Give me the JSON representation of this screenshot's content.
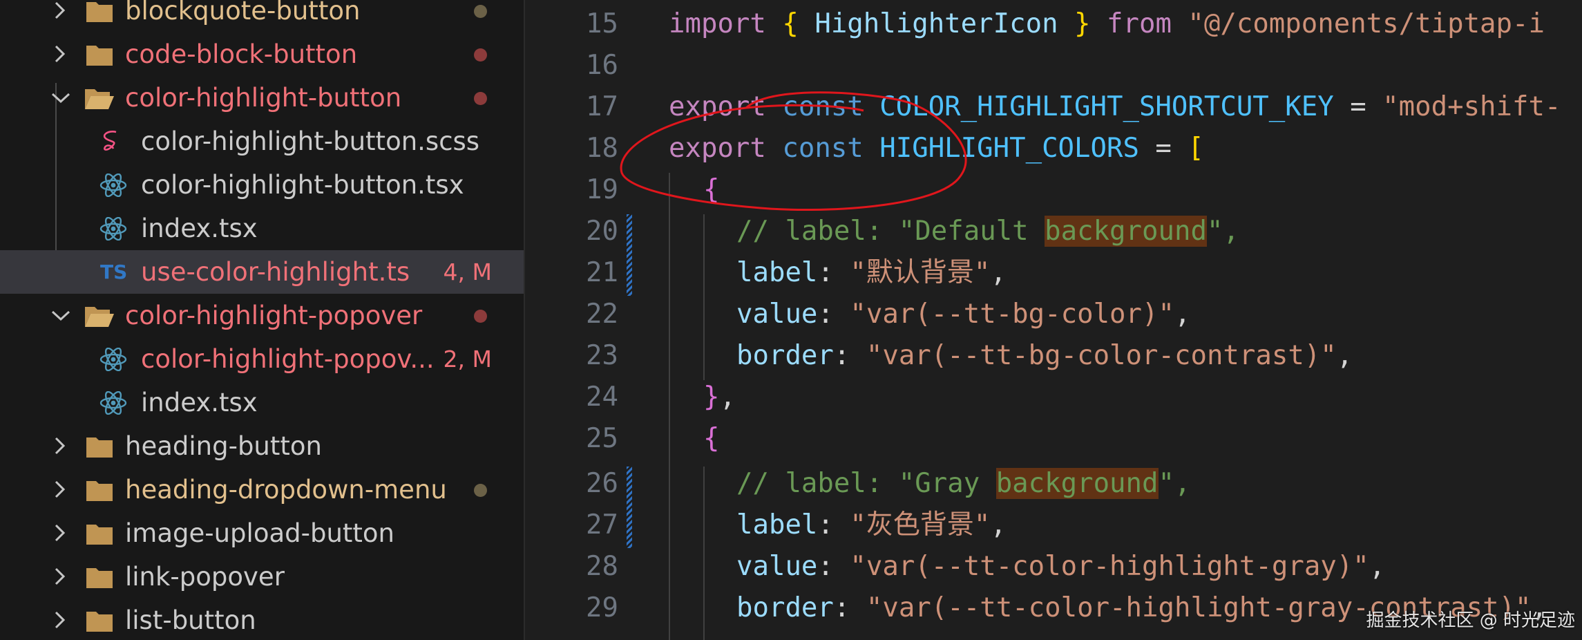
{
  "explorer": {
    "rows": [
      {
        "label": "blockquote-button",
        "color": "#e2c08d",
        "status": "modified-dot"
      },
      {
        "label": "code-block-button",
        "color": "#f07178",
        "status": "error-dot"
      },
      {
        "label": "color-highlight-button",
        "color": "#f07178",
        "status": "error-dot"
      },
      {
        "label": "color-highlight-button.scss",
        "color": "#cccccc",
        "icon": "sass-icon"
      },
      {
        "label": "color-highlight-button.tsx",
        "color": "#cccccc",
        "icon": "react-icon"
      },
      {
        "label": "index.tsx",
        "color": "#cccccc",
        "icon": "react-icon"
      },
      {
        "label": "use-color-highlight.ts",
        "color": "#f07178",
        "icon": "typescript-icon",
        "icon_text": "TS",
        "badge": "4, M"
      },
      {
        "label": "color-highlight-popover",
        "color": "#f07178",
        "status": "error-dot"
      },
      {
        "label": "color-highlight-popov...",
        "color": "#f07178",
        "icon": "react-icon",
        "badge": "2, M"
      },
      {
        "label": "index.tsx",
        "color": "#cccccc",
        "icon": "react-icon"
      },
      {
        "label": "heading-button",
        "color": "#cccccc"
      },
      {
        "label": "heading-dropdown-menu",
        "color": "#e2c08d",
        "status": "modified-dot"
      },
      {
        "label": "image-upload-button",
        "color": "#cccccc"
      },
      {
        "label": "link-popover",
        "color": "#cccccc"
      },
      {
        "label": "list-button",
        "color": "#cccccc"
      }
    ]
  },
  "editor": {
    "line_numbers": [
      "15",
      "16",
      "17",
      "18",
      "19",
      "20",
      "21",
      "22",
      "23",
      "24",
      "25",
      "26",
      "27",
      "28",
      "29"
    ],
    "line15": {
      "import": "import",
      "brace_open": "{ ",
      "name": "HighlighterIcon",
      "brace_close": " }",
      "from": "from",
      "path": "\"@/components/tiptap-i"
    },
    "line17": {
      "export": "export",
      "const": "const",
      "name": "COLOR_HIGHLIGHT_SHORTCUT_KEY",
      "eq": " = ",
      "value": "\"mod+shift-"
    },
    "line18": {
      "export": "export",
      "const": "const",
      "name": "HIGHLIGHT_COLORS",
      "eq": " = ",
      "bracket": "["
    },
    "line19": {
      "brace": "{"
    },
    "line20": {
      "comment_pre": "// label: \"Default ",
      "comment_hl": "background",
      "comment_post": "\","
    },
    "line21": {
      "key": "label",
      "colon": ": ",
      "value": "\"默认背景\"",
      "comma": ","
    },
    "line22": {
      "key": "value",
      "colon": ": ",
      "value": "\"var(--tt-bg-color)\"",
      "comma": ","
    },
    "line23": {
      "key": "border",
      "colon": ": ",
      "value": "\"var(--tt-bg-color-contrast)\"",
      "comma": ","
    },
    "line24": {
      "brace": "}",
      "comma": ","
    },
    "line25": {
      "brace": "{"
    },
    "line26": {
      "comment_pre": "// label: \"Gray ",
      "comment_hl": "background",
      "comment_post": "\","
    },
    "line27": {
      "key": "label",
      "colon": ": ",
      "value": "\"灰色背景\"",
      "comma": ","
    },
    "line28": {
      "key": "value",
      "colon": ": ",
      "value": "\"var(--tt-color-highlight-gray)\"",
      "comma": ","
    },
    "line29": {
      "key": "border",
      "colon": ": ",
      "value": "\"var(--tt-color-highlight-gray-contrast)\"",
      "comma": ","
    }
  },
  "watermark": "掘金技术社区 @ 时光足迹",
  "colors": {
    "error_dot": "#8c3b3b",
    "modified_dot": "#6b6147",
    "folder": "#c09553",
    "react": "#519aba",
    "sass": "#f55385",
    "typescript": "#3178c6",
    "annotation": "#e0161c"
  }
}
